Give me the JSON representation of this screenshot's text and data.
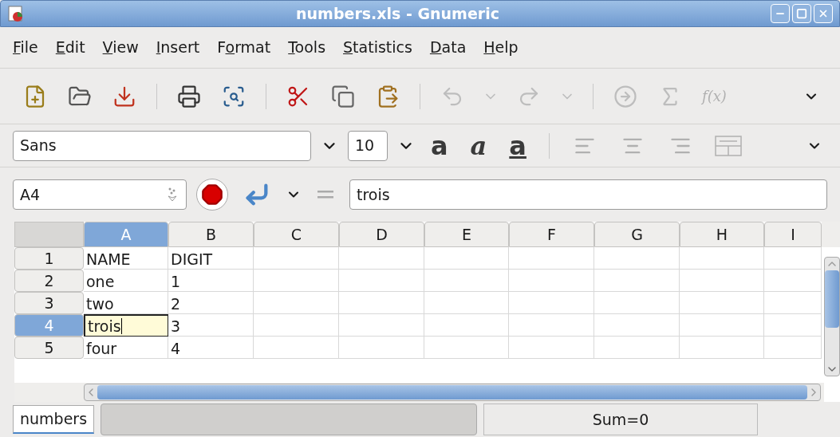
{
  "window": {
    "title": "numbers.xls - Gnumeric"
  },
  "menu": [
    {
      "key": "F",
      "post": "ile"
    },
    {
      "key": "E",
      "post": "dit"
    },
    {
      "key": "V",
      "post": "iew"
    },
    {
      "key": "I",
      "post": "nsert"
    },
    {
      "pre": "F",
      "key": "o",
      "post": "rmat"
    },
    {
      "key": "T",
      "post": "ools"
    },
    {
      "key": "S",
      "post": "tatistics"
    },
    {
      "key": "D",
      "post": "ata"
    },
    {
      "key": "H",
      "post": "elp"
    }
  ],
  "toolbar": [
    {
      "kind": "new",
      "disabled": false
    },
    {
      "kind": "open",
      "disabled": false
    },
    {
      "kind": "save",
      "disabled": false
    },
    {
      "kind": "sep"
    },
    {
      "kind": "print",
      "disabled": false
    },
    {
      "kind": "preview",
      "disabled": false
    },
    {
      "kind": "sep"
    },
    {
      "kind": "cut",
      "disabled": false
    },
    {
      "kind": "copy",
      "disabled": false
    },
    {
      "kind": "paste",
      "disabled": false
    },
    {
      "kind": "sep"
    },
    {
      "kind": "undo",
      "disabled": true
    },
    {
      "kind": "dropdown",
      "disabled": true
    },
    {
      "kind": "redo",
      "disabled": true
    },
    {
      "kind": "dropdown",
      "disabled": true
    },
    {
      "kind": "sep"
    },
    {
      "kind": "goto",
      "disabled": true
    },
    {
      "kind": "sum",
      "disabled": true
    },
    {
      "kind": "function",
      "label": "f(x)",
      "disabled": true
    }
  ],
  "format_bar": {
    "font": "Sans",
    "size": "10",
    "bold": "a",
    "italic": "a",
    "underline": "a"
  },
  "formula_bar": {
    "cell": "A4",
    "value": "trois"
  },
  "grid": {
    "columns": [
      {
        "label": "A",
        "selected": true
      },
      {
        "label": "B",
        "selected": false
      },
      {
        "label": "C",
        "selected": false
      },
      {
        "label": "D",
        "selected": false
      },
      {
        "label": "E",
        "selected": false
      },
      {
        "label": "F",
        "selected": false
      },
      {
        "label": "G",
        "selected": false
      },
      {
        "label": "H",
        "selected": false
      },
      {
        "label": "I",
        "selected": false
      }
    ],
    "rows": [
      {
        "label": "1",
        "selected": false,
        "cells": [
          "NAME",
          "DIGIT"
        ]
      },
      {
        "label": "2",
        "selected": false,
        "cells": [
          "one",
          "1"
        ]
      },
      {
        "label": "3",
        "selected": false,
        "cells": [
          "two",
          "2"
        ]
      },
      {
        "label": "4",
        "selected": true,
        "cells": [
          "trois",
          "3"
        ]
      },
      {
        "label": "5",
        "selected": false,
        "cells": [
          "four",
          "4"
        ]
      }
    ]
  },
  "sheet_tabs": [
    {
      "label": "numbers",
      "selected": true
    }
  ],
  "status_bar": {
    "sum": "Sum=0"
  }
}
